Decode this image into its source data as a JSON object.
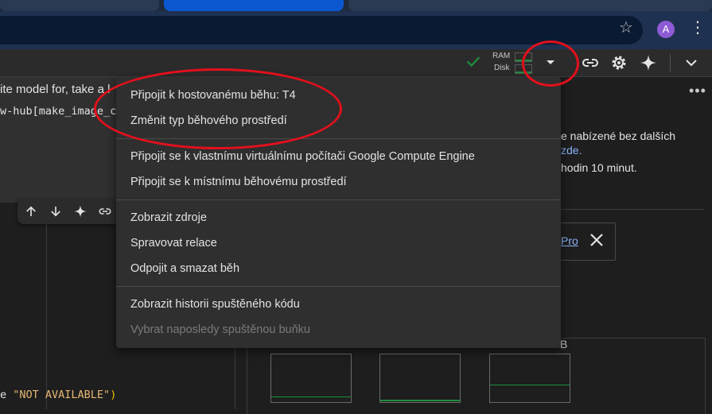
{
  "browser": {
    "avatar_letter": "A"
  },
  "toolbar": {
    "ram_label": "RAM",
    "disk_label": "Disk"
  },
  "cell": {
    "text_line_1": "ite model for, take a l",
    "text_line_2": "w-hub[make_image_c",
    "code_prefix": "e ",
    "code_string": "\"NOT AVAILABLE\"",
    "code_paren": ")"
  },
  "menu": {
    "items": [
      {
        "label": "Připojit k hostovanému běhu: T4"
      },
      {
        "label": "Změnit typ běhového prostředí"
      },
      {
        "label": "Připojit se k vlastnímu virtuálnímu počítači Google Compute Engine"
      },
      {
        "label": "Připojit se k místnímu běhovému prostředí"
      },
      {
        "label": "Zobrazit zdroje"
      },
      {
        "label": "Spravovat relace"
      },
      {
        "label": "Odpojit a smazat běh"
      },
      {
        "label": "Zobrazit historii spuštěného kódu"
      },
      {
        "label": "Vybrat naposledy spuštěnou buňku",
        "disabled": true
      }
    ]
  },
  "panel": {
    "text_1": "e nabízené bez dalších",
    "text_2": "zde.",
    "text_3": "hodin 10 minut.",
    "promo_link": "Pro",
    "resource_label": "B"
  },
  "colors": {
    "annotation": "#e3101c",
    "status_ok": "#1e8e3e",
    "link": "#8ab4f8"
  }
}
